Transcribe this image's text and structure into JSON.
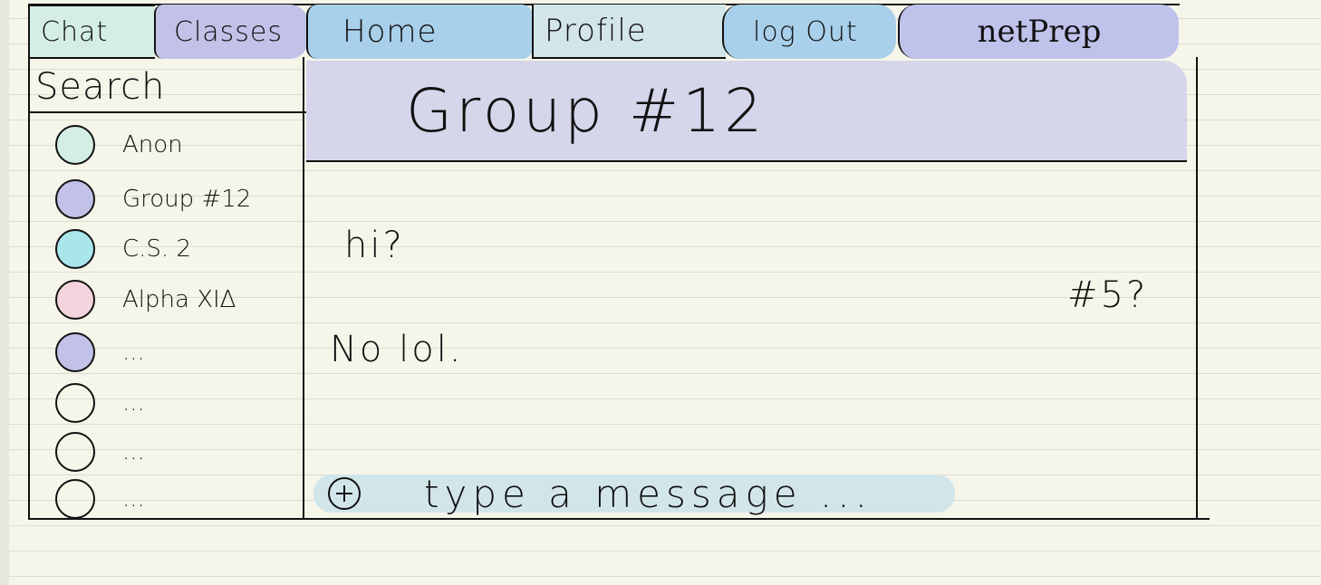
{
  "nav": {
    "chat": "Chat",
    "classes": "Classes",
    "home": "Home",
    "profile": "Profile",
    "logout": "log Out",
    "brand": "netPrep"
  },
  "sidebar": {
    "search_label": "Search",
    "chats": [
      {
        "name": "Anon",
        "color": "#d5eee4"
      },
      {
        "name": "Group #12",
        "color": "#c2c2e8"
      },
      {
        "name": "C.S. 2",
        "color": "#a8e6ea"
      },
      {
        "name": "Alpha XIΔ",
        "color": "#f3d4dc"
      },
      {
        "name": "...",
        "color": "#c2c2e8"
      },
      {
        "name": "...",
        "color": ""
      },
      {
        "name": "...",
        "color": ""
      },
      {
        "name": "...",
        "color": ""
      }
    ]
  },
  "main": {
    "title": "Group #12",
    "messages": [
      "hi?",
      "No lol.",
      "#5?"
    ],
    "composer_placeholder": "type a message ..."
  }
}
